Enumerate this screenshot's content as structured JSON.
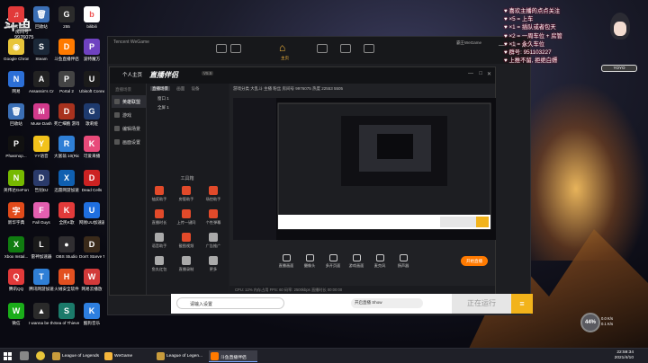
{
  "desktop": {
    "douyu": {
      "logo": "斗鱼",
      "room_label": "房间号",
      "room_id": "9976075"
    },
    "icons": [
      {
        "label": "网易云音乐",
        "color": "#e23a3a",
        "glyph": "♫"
      },
      {
        "label": "回收站",
        "color": "#3b6fb5",
        "glyph": "🗑"
      },
      {
        "label": "255",
        "color": "#2b2b2b",
        "glyph": "G"
      },
      {
        "label": "bilibili",
        "color": "#fff",
        "glyph": "b"
      },
      {
        "label": "Google Chrome",
        "color": "#e8c53a",
        "glyph": "◉"
      },
      {
        "label": "Steam",
        "color": "#1b2838",
        "glyph": "S"
      },
      {
        "label": "斗鱼直播伴侣",
        "color": "#ff7a00",
        "glyph": "D"
      },
      {
        "label": "波特魔方",
        "color": "#6f42c1",
        "glyph": "P"
      },
      {
        "label": "网易",
        "color": "#2c6fd6",
        "glyph": "N"
      },
      {
        "label": "Assassin's Creed Od...",
        "color": "#222",
        "glyph": "A"
      },
      {
        "label": "Portal 2",
        "color": "#444",
        "glyph": "P"
      },
      {
        "label": "Ubisoft Connect",
        "color": "#1b1b1b",
        "glyph": "U"
      },
      {
        "label": "回收站",
        "color": "#3b6fb5",
        "glyph": "🗑"
      },
      {
        "label": "Muse Dash",
        "color": "#d23a8c",
        "glyph": "M"
      },
      {
        "label": "死亡细胞 游戏",
        "color": "#a8321e",
        "glyph": "D"
      },
      {
        "label": "歌莉娅",
        "color": "#1e3a6e",
        "glyph": "G"
      },
      {
        "label": "Phasmop...",
        "color": "#111",
        "glyph": "P"
      },
      {
        "label": "YY语音",
        "color": "#f2c21b",
        "glyph": "Y"
      },
      {
        "label": "大富翁 10(Richm...",
        "color": "#2f7fd6",
        "glyph": "R"
      },
      {
        "label": "可爱来播",
        "color": "#e84a7a",
        "glyph": "K"
      },
      {
        "label": "英伟达GeForce",
        "color": "#76b900",
        "glyph": "N"
      },
      {
        "label": "告别DJ",
        "color": "#2a3a6a",
        "glyph": "D"
      },
      {
        "label": "迅雷网游加速",
        "color": "#0f5fb0",
        "glyph": "X"
      },
      {
        "label": "Dead Cells",
        "color": "#c22",
        "glyph": "D"
      },
      {
        "label": "新华字典",
        "color": "#e04a1a",
        "glyph": "字"
      },
      {
        "label": "Fall Guys",
        "color": "#e35fb0",
        "glyph": "F"
      },
      {
        "label": "全民K歌",
        "color": "#e23a3a",
        "glyph": "K"
      },
      {
        "label": "网易UU加速器",
        "color": "#1f6fe0",
        "glyph": "U"
      },
      {
        "label": "Xbox Instal...",
        "color": "#107c10",
        "glyph": "X"
      },
      {
        "label": "雷神加速器",
        "color": "#1a1a1a",
        "glyph": "L"
      },
      {
        "label": "OBS Studio",
        "color": "#302e31",
        "glyph": "●"
      },
      {
        "label": "Don't Starve Together",
        "color": "#3a2a1a",
        "glyph": "D"
      },
      {
        "label": "腾讯QQ",
        "color": "#e23a3a",
        "glyph": "Q"
      },
      {
        "label": "腾讯网游加速",
        "color": "#2f7fd6",
        "glyph": "T"
      },
      {
        "label": "火绒安全软件",
        "color": "#e35020",
        "glyph": "H"
      },
      {
        "label": "网易云播放",
        "color": "#d23a3a",
        "glyph": "W"
      },
      {
        "label": "微信",
        "color": "#1aad19",
        "glyph": "W"
      },
      {
        "label": "I wanna be the Creator",
        "color": "#2a2a2a",
        "glyph": "▲"
      },
      {
        "label": "Sea of Thieves",
        "color": "#1b7a6a",
        "glyph": "S"
      },
      {
        "label": "酷狗音乐",
        "color": "#2d7fe0",
        "glyph": "K"
      }
    ]
  },
  "wegame": {
    "title": "Tencent WeGame",
    "home_label": "主页",
    "user": "霸王WeGame",
    "win_min": "—",
    "win_max": "□",
    "win_close": "✕"
  },
  "assistant": {
    "mode": "个人主页",
    "brand": "直播伴侣",
    "version": "V5.5",
    "side_section": "直播场景",
    "side_items": [
      "英雄联盟",
      "游戏",
      "编辑场景",
      "画面设置"
    ],
    "scene_tabs": [
      "直播场景",
      "画面",
      "设备"
    ],
    "scene_rows": [
      "窗口 1",
      "全屏 1"
    ],
    "tools_header": "工具箱",
    "tools": [
      {
        "label": "抽奖助手",
        "color": "#e24a2a"
      },
      {
        "label": "房管助手",
        "color": "#e24a2a"
      },
      {
        "label": "场控助手",
        "color": "#e24a2a"
      },
      {
        "label": "直播时长",
        "color": "#e24a2a"
      },
      {
        "label": "上传一键同",
        "color": "#e24a2a"
      },
      {
        "label": "个性弹幕",
        "color": "#e24a2a"
      },
      {
        "label": "语音助手",
        "color": "#aaa"
      },
      {
        "label": "截图视频",
        "color": "#e24a2a"
      },
      {
        "label": "广告推广",
        "color": "#aaa"
      },
      {
        "label": "鱼丸红包",
        "color": "#aaa"
      },
      {
        "label": "直播录制",
        "color": "#aaa"
      },
      {
        "label": "更多",
        "color": "#aaa"
      }
    ],
    "meta": "游戏分类  大乱斗  主播   粉丝   房间号 9976075   热度 22553   5505",
    "controls": [
      "直播画面",
      "摄像头",
      "多开页面",
      "游戏画面",
      "麦克风",
      "扬声器"
    ],
    "golive": "开始直播",
    "status": "CPU: 12%  内存占用  FPS: 60  码率: 2500kbps  直播时长 00:00:00",
    "hint": "您以普通人身份进入直播伴侣"
  },
  "runbar": {
    "placeholder": "请输入设置",
    "check_label": "开启直播 Show",
    "run_label": "正在运行",
    "menu": "≡"
  },
  "notice": {
    "rows": [
      "♥ 喜欢主播的点点关注",
      "♥ ×5 = 上车",
      "♥ ×1 = 插队或者包天",
      "♥ ×2 = 一周车位 + 房管",
      "♥ ×1 = 永久车位",
      "♥ 群号: 951103227",
      "♥ 上推不留, 拒绝白嫖"
    ]
  },
  "avatar": {
    "name": "YOYO"
  },
  "speed": {
    "value": "44%",
    "up": "0.0 K/s",
    "down": "0.1 K/s"
  },
  "taskbar": {
    "tasks": [
      {
        "label": "League of Legends",
        "color": "#c89b3c"
      },
      {
        "label": "WeGame",
        "color": "#f6b63c"
      },
      {
        "label": "League of Legen...",
        "color": "#c89b3c"
      },
      {
        "label": "斗鱼直播伴侣",
        "color": "#ff7a00"
      }
    ],
    "time": "22:59:34",
    "date": "2021/4/10"
  }
}
